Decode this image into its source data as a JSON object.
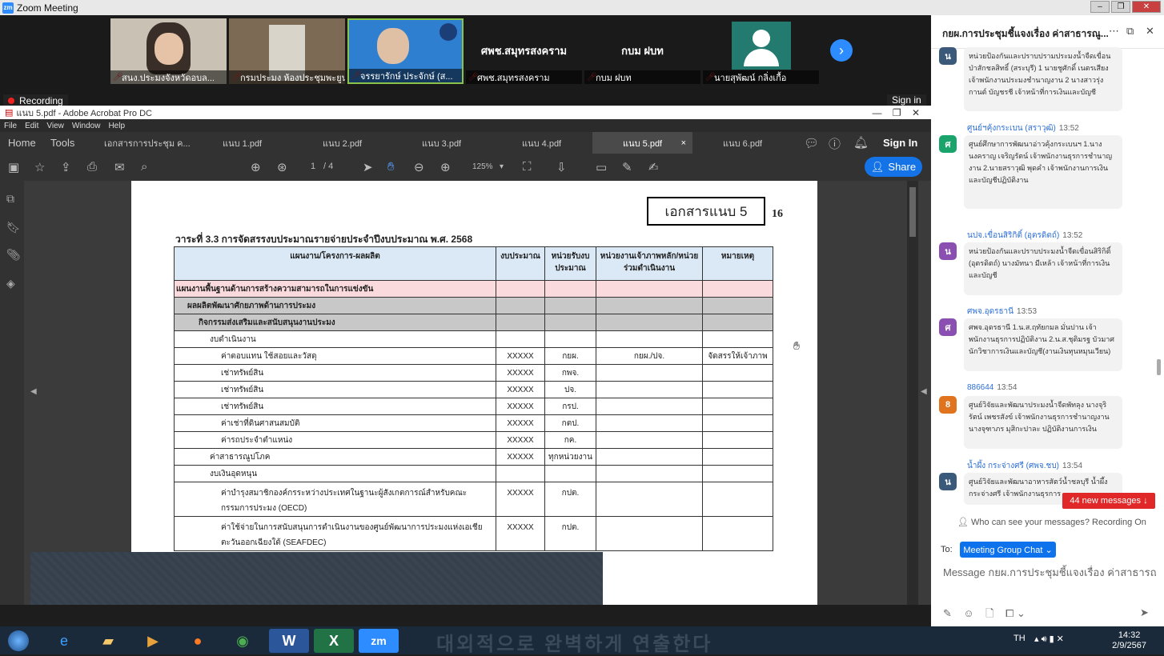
{
  "zoom": {
    "title": "Zoom Meeting",
    "recording_label": "Recording",
    "sign_in": "Sign in",
    "tiles": [
      {
        "caption": "สนง.ประมงจังหวัดอบล...",
        "kind": "video"
      },
      {
        "caption": "กรมประมง ห้องประชุมพะยูน",
        "kind": "video"
      },
      {
        "caption": "จรรยารักษ์ ประจักษ์ (ส...",
        "kind": "video"
      },
      {
        "caption": "ศพช.สมุทรสงคราม",
        "name": "ศพช.สมุทรสงคราม",
        "kind": "name"
      },
      {
        "caption": "กบม ฝบท",
        "name": "กบม ฝบท",
        "kind": "name"
      },
      {
        "caption": "นายสุพัฒน์ กลิ่งเกื้อ",
        "kind": "avatar"
      }
    ]
  },
  "acrobat": {
    "title": "แนบ 5.pdf - Adobe Acrobat Pro DC",
    "menu": [
      "File",
      "Edit",
      "View",
      "Window",
      "Help"
    ],
    "tabs": [
      "Home",
      "Tools",
      "เอกสารการประชุม ค...",
      "แนบ 1.pdf",
      "แนบ 2.pdf",
      "แนบ 3.pdf",
      "แนบ 4.pdf",
      "แนบ 5.pdf",
      "แนบ 6.pdf"
    ],
    "active_tab": "แนบ 5.pdf",
    "sign_in": "Sign In",
    "page_current": "1",
    "page_total": "/ 4",
    "zoom": "125%",
    "share": "Share"
  },
  "document": {
    "badge": "เอกสารแนบ 5",
    "page_no": "16",
    "agenda": "วาระที่ 3.3 การจัดสรรงบประมาณรายจ่ายประจำปีงบประมาณ พ.ศ. 2568",
    "headers": [
      "แผนงาน/โครงการ-ผลผลิต",
      "งบประมาณ",
      "หน่วยรับงบประมาณ",
      "หน่วยงานเจ้าภาพหลัก/หน่วยร่วมดำเนินงาน",
      "หมายเหตุ"
    ],
    "rows": [
      {
        "style": "pink",
        "indent": 0,
        "cells": [
          "แผนงานพื้นฐานด้านการสร้างความสามารถในการแข่งขัน",
          "",
          "",
          "",
          ""
        ]
      },
      {
        "style": "grey",
        "indent": 1,
        "cells": [
          "ผลผลิตพัฒนาศักยภาพด้านการประมง",
          "",
          "",
          "",
          ""
        ]
      },
      {
        "style": "grey",
        "indent": 2,
        "cells": [
          "กิจกรรมส่งเสริมและสนับสนุนงานประมง",
          "",
          "",
          "",
          ""
        ]
      },
      {
        "style": "",
        "indent": 3,
        "cells": [
          "งบดำเนินงาน",
          "",
          "",
          "",
          ""
        ]
      },
      {
        "style": "",
        "indent": 4,
        "cells": [
          "ค่าตอบแทน ใช้สอยและวัสดุ",
          "XXXXX",
          "กยผ.",
          "กยผ./ปจ.",
          "จัดสรรให้เจ้าภาพ"
        ]
      },
      {
        "style": "",
        "indent": 4,
        "cells": [
          "เช่าทรัพย์สิน",
          "XXXXX",
          "กพจ.",
          "",
          ""
        ]
      },
      {
        "style": "",
        "indent": 4,
        "cells": [
          "เช่าทรัพย์สิน",
          "XXXXX",
          "ปจ.",
          "",
          ""
        ]
      },
      {
        "style": "",
        "indent": 4,
        "cells": [
          "เช่าทรัพย์สิน",
          "XXXXX",
          "กรป.",
          "",
          ""
        ]
      },
      {
        "style": "",
        "indent": 4,
        "cells": [
          "ค่าเช่าที่ดินศาสนสมบัติ",
          "XXXXX",
          "กตป.",
          "",
          ""
        ]
      },
      {
        "style": "",
        "indent": 4,
        "cells": [
          "ค่ารถประจำตำแหน่ง",
          "XXXXX",
          "กค.",
          "",
          ""
        ]
      },
      {
        "style": "",
        "indent": 3,
        "cells": [
          "ค่าสาธารณูปโภค",
          "XXXXX",
          "ทุกหน่วยงาน",
          "",
          ""
        ]
      },
      {
        "style": "",
        "indent": 3,
        "cells": [
          "งบเงินอุดหนุน",
          "",
          "",
          "",
          ""
        ]
      },
      {
        "style": "tall",
        "indent": 4,
        "cells": [
          "ค่าบำรุงสมาชิกองค์กรระหว่างประเทศในฐานะผู้สังเกตการณ์สำหรับคณะกรรมการประมง (OECD)",
          "XXXXX",
          "กปต.",
          "",
          ""
        ]
      },
      {
        "style": "tall",
        "indent": 4,
        "cells": [
          "ค่าใช้จ่ายในการสนับสนุนการดำเนินงานของศูนย์พัฒนาการประมงแห่งเอเชียตะวันออกเฉียงใต้ (SEAFDEC)",
          "XXXXX",
          "กปต.",
          "",
          ""
        ]
      }
    ]
  },
  "chat": {
    "title": "กยผ.การประชุมชี้แจงเรื่อง ค่าสาธารณู...",
    "messages": [
      {
        "initial": "น",
        "color": "#3b5a7a",
        "name": "",
        "time": "",
        "text": "หน่วยป้องกันและปราบปรามประมงน้ำจืดเขื่อนป่าสักชลสิทธิ์ (สระบุรี) 1 นายชูศักดิ์ เนตรเสียง เจ้าพนักงานประมงชำนาญงาน 2 นางสาวรุ่งกานต์ บัญชรชี เจ้าหน้าที่การเงินและบัญชี"
      },
      {
        "initial": "ศ",
        "color": "#1aa36b",
        "name": "ศูนย์ฯคุ้งกระเบน (สราวุฒิ)",
        "time": "13:52",
        "text": "ศูนย์ศึกษาการพัฒนาอ่าวคุ้งกระเบนฯ 1.นางนงคราญ เจริญรัตน์ เจ้าพนักงานธุรการชำนาญงาน 2.นายสราวุฒิ พุดคำ เจ้าพนักงานการเงินและบัญชีปฏิบัติงาน"
      },
      {
        "initial": "น",
        "color": "#8a4fb0",
        "name": "นปจ.เขื่อนสิริกิติ์ (อุตรดิตถ์)",
        "time": "13:52",
        "text": "หน่วยป้องกันและปราบประมงน้ำจืดเขื่อนสิริกิติ์ (อุตรดิตถ์) นางมัทนา มีเหล้า เจ้าหน้าที่การเงินและบัญชี"
      },
      {
        "initial": "ศ",
        "color": "#8a4fb0",
        "name": "ศพจ.อุดรธานี",
        "time": "13:53",
        "text": "ศพจ.อุดรธานี 1.น.ส.ฤทัยกมล มั่นปาน เจ้าพนักงานธุรการปฏิบัติงาน 2.น.ส.ชุติมรฐ บัวมาศ นักวิชาการเงินและบัญชี(งานเงินทุนหมุนเวียน)"
      },
      {
        "initial": "8",
        "color": "#e0731d",
        "name": "886644",
        "time": "13:54",
        "text": "ศูนย์วิจัยและพัฒนาประมงน้ำจืดพัทลุง นางจุริรัตน์ เพชรสังข์ เจ้าพนักงานธุรการชำนาญงาน นางจุฑาภร มุสิกะปาละ ปฏิบัติงานการเงิน"
      },
      {
        "initial": "น",
        "color": "#3b5a7a",
        "name": "น้ำผึ้ง กระจ่างศรี (ศพจ.ชบ)",
        "time": "13:54",
        "text": "ศูนย์วิจัยและพัฒนาอาหารสัตว์น้ำชลบุรี น้ำผึ้ง กระจ่างศรี เจ้าพนักงานธุรการ"
      }
    ],
    "new_messages": "44 new messages ↓",
    "visibility": "Who can see your messages? Recording On",
    "to_label": "To:",
    "to_target": "Meeting Group Chat ⌄",
    "input_placeholder": "Message กยผ.การประชุมชี้แจงเรื่อง ค่าสาธารณูป..."
  },
  "taskbar": {
    "lang": "TH",
    "time": "14:32",
    "date": "2/9/2567",
    "ghost_caption": "대외적으로 완벽하게 연출한다"
  }
}
